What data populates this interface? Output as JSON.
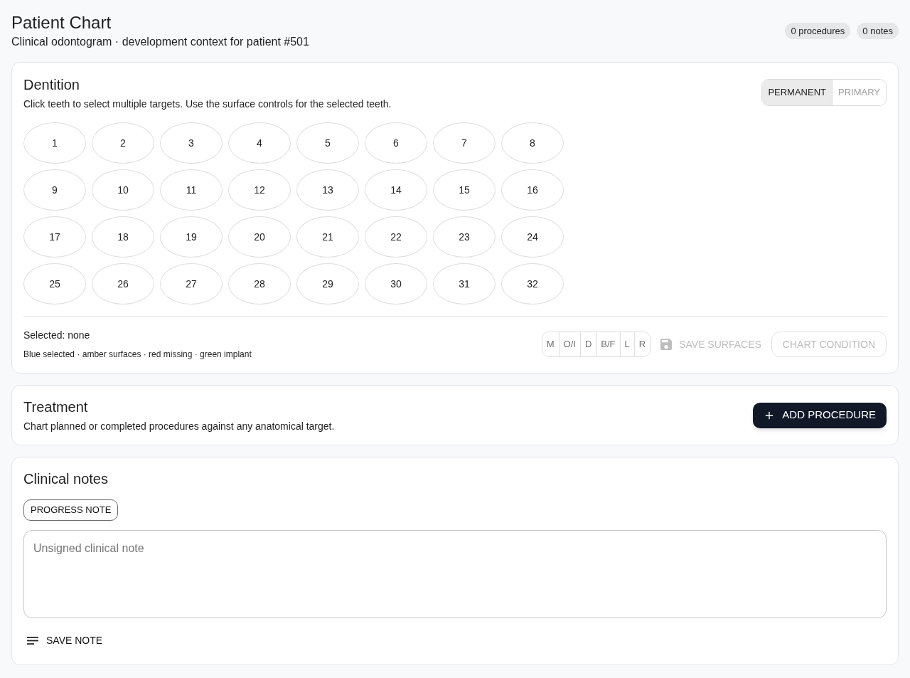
{
  "header": {
    "title": "Patient Chart",
    "subtitle": "Clinical odontogram · development context for patient #501",
    "badges": [
      "0 procedures",
      "0 notes"
    ]
  },
  "dentition": {
    "title": "Dentition",
    "description": "Click teeth to select multiple targets. Use the surface controls for the selected teeth.",
    "dentition_types": [
      {
        "label": "PERMANENT",
        "selected": true
      },
      {
        "label": "PRIMARY",
        "selected": false
      }
    ],
    "teeth": [
      {
        "number": "1",
        "selected": false
      },
      {
        "number": "2",
        "selected": false
      },
      {
        "number": "3",
        "selected": false
      },
      {
        "number": "4",
        "selected": false
      },
      {
        "number": "5",
        "selected": false
      },
      {
        "number": "6",
        "selected": false
      },
      {
        "number": "7",
        "selected": false
      },
      {
        "number": "8",
        "selected": false
      },
      {
        "number": "9",
        "selected": false
      },
      {
        "number": "10",
        "selected": false
      },
      {
        "number": "11",
        "selected": false
      },
      {
        "number": "12",
        "selected": false
      },
      {
        "number": "13",
        "selected": false
      },
      {
        "number": "14",
        "selected": false
      },
      {
        "number": "15",
        "selected": false
      },
      {
        "number": "16",
        "selected": false
      },
      {
        "number": "17",
        "selected": false
      },
      {
        "number": "18",
        "selected": false
      },
      {
        "number": "19",
        "selected": false
      },
      {
        "number": "20",
        "selected": false
      },
      {
        "number": "21",
        "selected": false
      },
      {
        "number": "22",
        "selected": false
      },
      {
        "number": "23",
        "selected": false
      },
      {
        "number": "24",
        "selected": false
      },
      {
        "number": "25",
        "selected": false
      },
      {
        "number": "26",
        "selected": false
      },
      {
        "number": "27",
        "selected": false
      },
      {
        "number": "28",
        "selected": false
      },
      {
        "number": "29",
        "selected": false
      },
      {
        "number": "30",
        "selected": false
      },
      {
        "number": "31",
        "selected": false
      },
      {
        "number": "32",
        "selected": false
      }
    ],
    "selected_summary": "Selected: none",
    "legend": "Blue selected · amber surfaces · red missing · green implant",
    "surfaces": [
      {
        "label": "M",
        "selected": false
      },
      {
        "label": "O/I",
        "selected": false
      },
      {
        "label": "D",
        "selected": false
      },
      {
        "label": "B/F",
        "selected": false
      },
      {
        "label": "L",
        "selected": false
      },
      {
        "label": "R",
        "selected": false
      }
    ],
    "save_surfaces": {
      "label": "SAVE SURFACES",
      "disabled": true
    },
    "chart_condition": {
      "label": "CHART CONDITION",
      "disabled": true
    }
  },
  "treatment": {
    "title": "Treatment",
    "description": "Chart planned or completed procedures against any anatomical target.",
    "add_button": "ADD PROCEDURE"
  },
  "clinical_notes": {
    "title": "Clinical notes",
    "note_type_button": "PROGRESS NOTE",
    "note_field": {
      "placeholder": "Unsigned clinical note"
    },
    "save_button": "SAVE NOTE"
  }
}
